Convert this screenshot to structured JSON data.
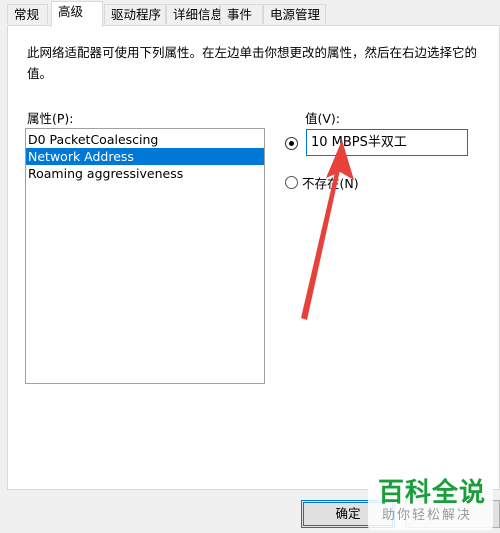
{
  "tabs": [
    {
      "label": "常规"
    },
    {
      "label": "高级"
    },
    {
      "label": "驱动程序"
    },
    {
      "label": "详细信息"
    },
    {
      "label": "事件"
    },
    {
      "label": "电源管理"
    }
  ],
  "description": "此网络适配器可使用下列属性。在左边单击你想更改的属性，然后在右边选择它的值。",
  "property_label": "属性(P):",
  "properties": [
    {
      "label": "D0 PacketCoalescing"
    },
    {
      "label": "Network Address"
    },
    {
      "label": "Roaming aggressiveness"
    }
  ],
  "value_label": "值(V):",
  "value_input": "10 MBPS半双工",
  "not_present_label": "不存在(N)",
  "ok_label": "确定",
  "watermark": {
    "title": "百科全说",
    "subtitle": "助你轻松解决"
  },
  "colors": {
    "selection": "#0078d7",
    "arrow": "#e8413c",
    "watermark": "#1a9e3a"
  }
}
